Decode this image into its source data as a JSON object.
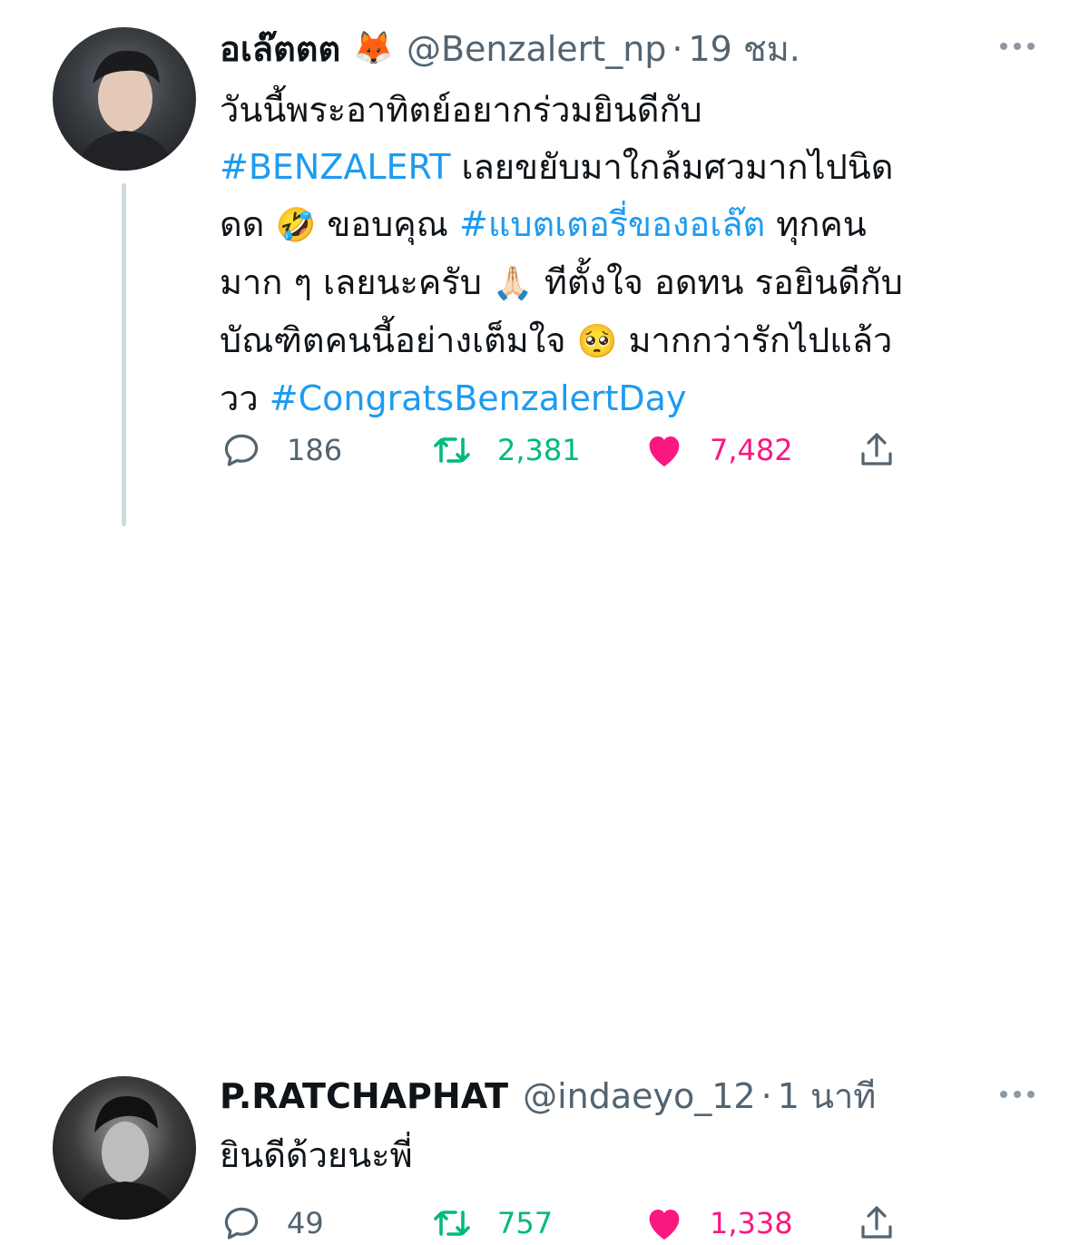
{
  "tweets": [
    {
      "name": "อเล๊ตตต",
      "name_emoji": "🦊",
      "handle": "@Benzalert_np",
      "separator": "·",
      "time": "19 ชม.",
      "lines": {
        "l1": "วันนี้พระอาทิตย์อยากร่วมยินดีกับ",
        "l2_tag": "#BENZALERT",
        "l2_text": " เลยขยับมาใกล้มศวมากไปนิด",
        "l3_text1": "ดด ",
        "l3_emoji": "🤣",
        "l3_text2": " ขอบคุณ ",
        "l3_tag": "#แบตเตอรี่ของอเล๊ต",
        "l3_text3": "  ทุกคน",
        "l4_text1": "มาก ๆ เลยนะครับ ",
        "l4_emoji": "🙏🏻",
        "l4_text2": " ทีตั้งใจ อดทน รอยินดีกับ",
        "l5_text1": "บัณฑิตคนนี้อย่างเต็มใจ ",
        "l5_emoji": "🥺",
        "l5_text2": " มากกว่ารักไปแล้ว",
        "l6_text": "วว ",
        "l6_tag": "#CongratsBenzalertDay"
      },
      "stats": {
        "replies": "186",
        "retweets": "2,381",
        "likes": "7,482"
      }
    },
    {
      "name": "P.RATCHAPHAT",
      "handle": "@indaeyo_12",
      "separator": "·",
      "time": "1 นาที",
      "text": "ยินดีด้วยนะพี่",
      "stats": {
        "replies": "49",
        "retweets": "757",
        "likes": "1,338"
      }
    }
  ],
  "icons": {
    "reply": "reply-icon",
    "retweet": "retweet-icon",
    "like": "heart-icon",
    "share": "share-icon",
    "more": "more-icon"
  },
  "colors": {
    "text": "#0f1419",
    "secondary": "#536471",
    "link": "#1d9bf0",
    "retweet": "#00ba7c",
    "like": "#f91880",
    "thread_line": "#cfd9de"
  }
}
